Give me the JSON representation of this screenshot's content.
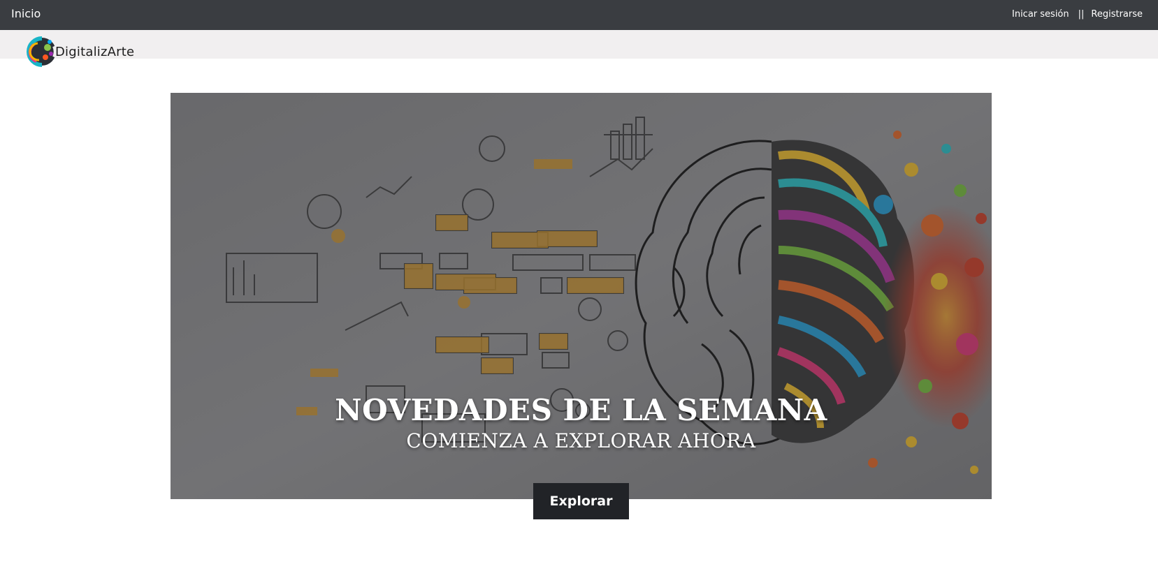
{
  "nav": {
    "home_label": "Inicio",
    "login_label": "Inicar sesión",
    "separator": "||",
    "register_label": "Registrarse"
  },
  "logo": {
    "text_part1": "Digitaliz",
    "text_part2": "Arte"
  },
  "hero": {
    "title": "NOVEDADES DE LA SEMANA",
    "subtitle": "COMIENZA A EXPLORAR AHORA",
    "button_label": "Explorar"
  },
  "colors": {
    "topbar": "#3a3d41",
    "logostrip": "#f1eff0",
    "button": "#212327"
  }
}
